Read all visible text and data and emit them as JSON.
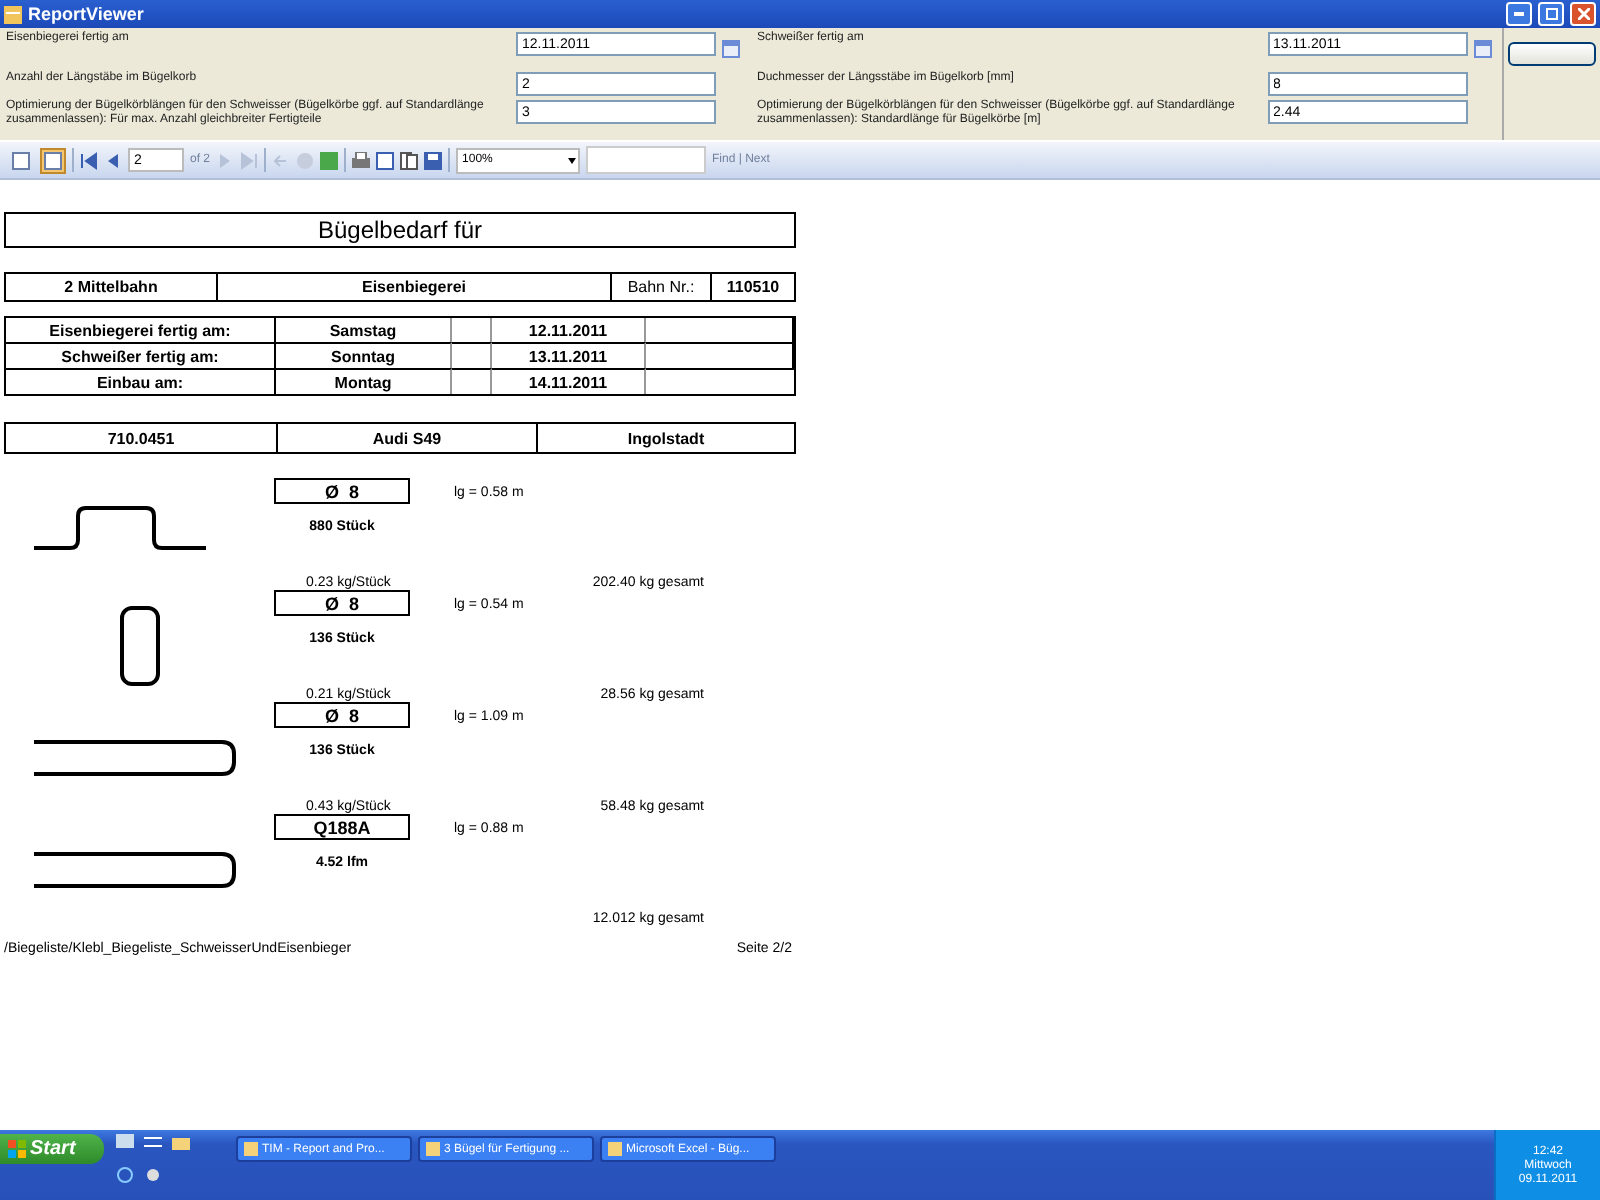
{
  "window": {
    "title": "ReportViewer"
  },
  "parameters": {
    "left": [
      {
        "kind": "date",
        "label": "Eisenbiegerei fertig am",
        "value": "12.11.2011"
      },
      {
        "kind": "text",
        "label": "Anzahl der Längstäbe im Bügelkorb",
        "value": "2"
      },
      {
        "kind": "text",
        "label": "Optimierung der Bügelkörblängen für den Schweisser (Bügelkörbe ggf. auf Standardlänge zusammenlassen): Für max. Anzahl gleichbreiter Fertigteile",
        "value": "3"
      }
    ],
    "right": [
      {
        "kind": "date",
        "label": "Schweißer fertig am",
        "value": "13.11.2011"
      },
      {
        "kind": "text",
        "label": "Duchmesser der Längsstäbe im Bügelkorb [mm]",
        "value": "8"
      },
      {
        "kind": "text",
        "label": "Optimierung der Bügelkörblängen für den Schweisser (Bügelkörbe ggf. auf Standardlänge zusammenlassen): Standardlänge für Bügelkörbe [m]",
        "value": "2.44"
      }
    ]
  },
  "toolbar": {
    "toggles": [
      {
        "selected": false
      },
      {
        "selected": true
      }
    ],
    "page": "2",
    "page_total": "of 2",
    "zoom": "100%",
    "find": "Find | Next"
  },
  "report": {
    "title": "Bügelbedarf für",
    "header": [
      "2 Mittelbahn",
      "Eisenbiegerei",
      "Bahn Nr.:",
      "110510"
    ],
    "schedule": [
      {
        "label": "Eisenbiegerei fertig am:",
        "day": "Samstag",
        "date": "12.11.2011"
      },
      {
        "label": "Schweißer fertig am:",
        "day": "Sonntag",
        "date": "13.11.2011"
      },
      {
        "label": "Einbau am:",
        "day": "Montag",
        "date": "14.11.2011"
      }
    ],
    "project": [
      "710.0451",
      "Audi S49",
      "Ingolstadt"
    ],
    "items": [
      {
        "kind": "hat",
        "size": "Ø  8",
        "length": "lg = 0.58 m",
        "quantity": "880 Stück",
        "unit_weight": "0.23 kg/Stück",
        "total": "202.40 kg gesamt"
      },
      {
        "kind": "loop",
        "size": "Ø  8",
        "length": "lg = 0.54 m",
        "quantity": "136 Stück",
        "unit_weight": "0.21 kg/Stück",
        "total": "28.56 kg gesamt"
      },
      {
        "kind": "u",
        "size": "Ø  8",
        "length": "lg = 1.09 m",
        "quantity": "136 Stück",
        "unit_weight": "0.43 kg/Stück",
        "total": "58.48 kg gesamt"
      },
      {
        "kind": "u",
        "size": "Q188A",
        "length": "lg = 0.88 m",
        "quantity": "4.52 lfm",
        "total": "12.012 kg gesamt"
      }
    ],
    "footer_path": "/Biegeliste/Klebl_Biegeliste_SchweisserUndEisenbieger",
    "footer_page": "Seite 2/2"
  },
  "taskbar": {
    "start": "Start",
    "tasks": [
      {
        "label": "TIM - Report and Pro...",
        "selected": false
      },
      {
        "label": "3 Bügel für Fertigung ...",
        "selected": false
      },
      {
        "label": "Microsoft Excel - Büg...",
        "selected": false
      }
    ],
    "clock": {
      "time": "12:42",
      "day": "Mittwoch",
      "date": "09.11.2011"
    }
  }
}
